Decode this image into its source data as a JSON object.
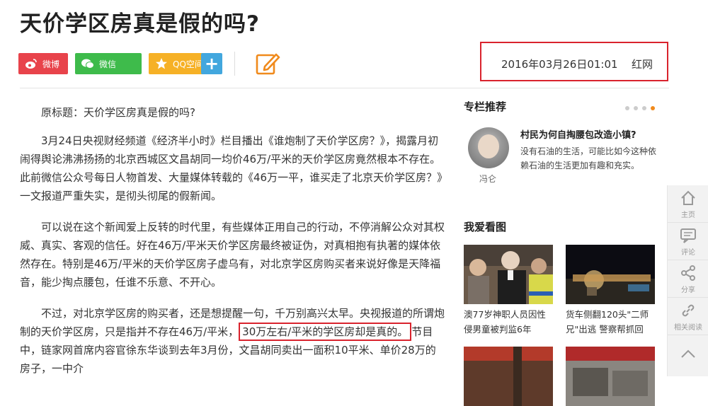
{
  "article": {
    "title": "天价学区房真是假的吗?",
    "date": "2016年03月26日01:01",
    "source": "红网",
    "paragraphs": {
      "p1": "原标题：天价学区房真是假的吗?",
      "p2": "3月24日央视财经频道《经济半小时》栏目播出《谁炮制了天价学区房？》，揭露月初闹得舆论沸沸扬扬的北京西城区文昌胡同一均价46万/平米的天价学区房竟然根本不存在。此前微信公众号每日人物首发、大量媒体转载的《46万一平，谁买走了北京天价学区房？》一文报道严重失实，是彻头彻尾的假新闻。",
      "p3": "可以说在这个新闻爱上反转的时代里，有些媒体正用自己的行动，不停消解公众对其权威、真实、客观的信任。好在46万/平米天价学区房最终被证伪，对真相抱有执著的媒体依然存在。特别是46万/平米的天价学区房子虚乌有，对北京学区房购买者来说好像是天降福音，能少掏点腰包，任谁不乐意、不开心。",
      "p4a": "不过，对北京学区房的购买者，还是想提醒一句，千万别高兴太早。央视报道的所谓炮制的天价学区房，只是指并不存在46万/平米，",
      "p4b": "30万左右/平米的学区房却是真的。",
      "p4c": "节目中，链家网首席内容官徐东华谈到去年3月份，文昌胡同卖出一面积10平米、单价28万的房子，一中介"
    }
  },
  "share": {
    "weibo": "微博",
    "weixin": "微信",
    "qzone": "QQ空间",
    "plus": "+"
  },
  "sidebar": {
    "column_title": "专栏推荐",
    "column": {
      "author": "冯仑",
      "headline": "村民为何自掏腰包改造小镇?",
      "desc": "没有石油的生活，可能比如今这种依赖石油的生活更加有趣和充实。"
    },
    "pics_title": "我爱看图",
    "cards": {
      "c1": "澳77岁神职人员因性侵男童被判监6年",
      "c2": "货车侧翻120头\"二师兄\"出逃 警察帮抓回"
    }
  },
  "toolbar": {
    "home": "主页",
    "comment": "评论",
    "share": "分享",
    "related": "相关阅读"
  },
  "colors": {
    "weibo": "#e8434b",
    "weixin": "#3ebb4b",
    "qzone": "#f6b126",
    "plus": "#42a7de",
    "highlight_border": "#d9232d",
    "edit_icon": "#f08a1c"
  }
}
